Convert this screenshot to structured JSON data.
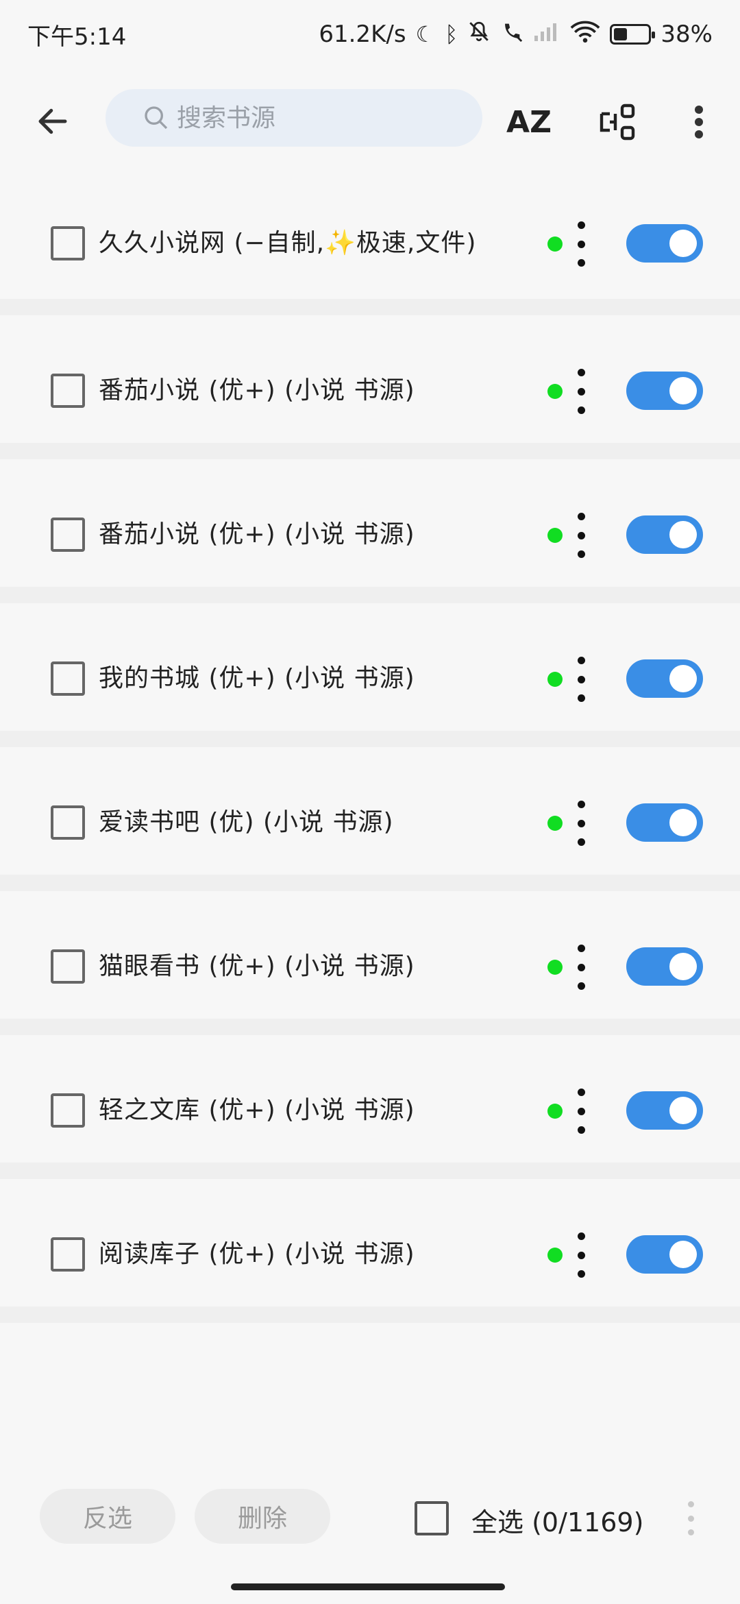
{
  "status_bar": {
    "time": "下午5:14",
    "net_speed": "61.2K/s",
    "battery_percent": "38%",
    "battery_level": 0.38,
    "icons": [
      "moon-icon",
      "bluetooth-icon",
      "mute-icon",
      "call-icon",
      "signal-icon",
      "wifi-icon",
      "battery-icon"
    ]
  },
  "toolbar": {
    "back_icon": "arrow-left-icon",
    "search_placeholder": "搜索书源",
    "sort_label": "AZ",
    "group_icon": "group-icon",
    "more_icon": "more-vertical-icon"
  },
  "sources": [
    {
      "label": "久久小说网 (−自制,✨极速,文件)",
      "checked": false,
      "enabled": true,
      "status_color": "#11dd22"
    },
    {
      "label": "番茄小说 (优+) (小说 书源)",
      "checked": false,
      "enabled": true,
      "status_color": "#11dd22"
    },
    {
      "label": "番茄小说 (优+) (小说 书源)",
      "checked": false,
      "enabled": true,
      "status_color": "#11dd22"
    },
    {
      "label": "我的书城 (优+) (小说 书源)",
      "checked": false,
      "enabled": true,
      "status_color": "#11dd22"
    },
    {
      "label": "爱读书吧 (优) (小说 书源)",
      "checked": false,
      "enabled": true,
      "status_color": "#11dd22"
    },
    {
      "label": "猫眼看书 (优+) (小说 书源)",
      "checked": false,
      "enabled": true,
      "status_color": "#11dd22"
    },
    {
      "label": "轻之文库 (优+) (小说 书源)",
      "checked": false,
      "enabled": true,
      "status_color": "#11dd22"
    },
    {
      "label": "阅读库子 (优+) (小说 书源)",
      "checked": false,
      "enabled": true,
      "status_color": "#11dd22"
    }
  ],
  "bottom_bar": {
    "invert_label": "反选",
    "delete_label": "删除",
    "select_all_label": "全选 (0/1169)"
  },
  "colors": {
    "accent": "#3a8ee6",
    "status_ok": "#11dd22",
    "search_bg": "#e8eef6"
  }
}
